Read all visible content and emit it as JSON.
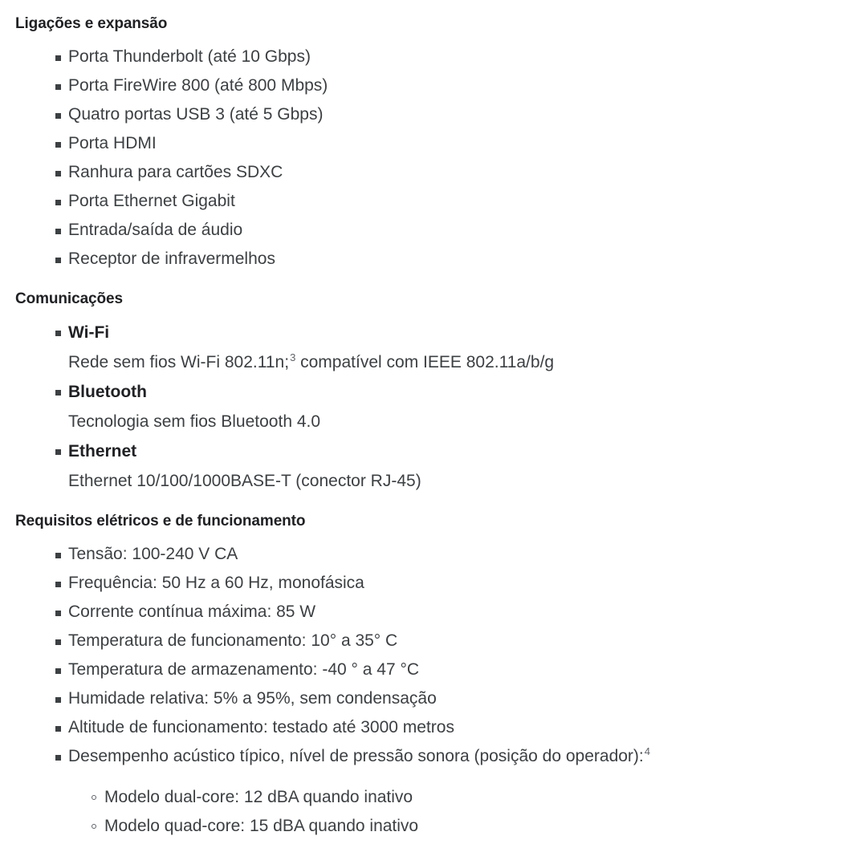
{
  "document": {
    "sections": [
      {
        "id": "ligacoes-e-expansao",
        "heading": "Ligações e expansão",
        "items": [
          {
            "text": "Porta Thunderbolt (até 10 Gbps)"
          },
          {
            "text": "Porta FireWire 800 (até 800 Mbps)"
          },
          {
            "text": "Quatro portas USB 3 (até 5 Gbps)"
          },
          {
            "text": "Porta HDMI"
          },
          {
            "text": "Ranhura para cartões SDXC"
          },
          {
            "text": "Porta Ethernet Gigabit"
          },
          {
            "text": "Entrada/saída de áudio"
          },
          {
            "text": "Receptor de infravermelhos"
          }
        ]
      },
      {
        "id": "comunicacoes",
        "heading": "Comunicações",
        "items": [
          {
            "term": "Wi-Fi",
            "desc_before": "Rede sem fios Wi-Fi 802.11n;",
            "footnote": "3",
            "desc_after": " compatível com IEEE 802.11a/b/g"
          },
          {
            "term": "Bluetooth",
            "desc_before": "Tecnologia sem fios Bluetooth 4.0",
            "footnote": "",
            "desc_after": ""
          },
          {
            "term": "Ethernet",
            "desc_before": "Ethernet 10/100/1000BASE-T (conector RJ-45)",
            "footnote": "",
            "desc_after": ""
          }
        ]
      },
      {
        "id": "requisitos-eletricos",
        "heading": "Requisitos elétricos e de funcionamento",
        "items": [
          {
            "text": "Tensão: 100-240 V CA"
          },
          {
            "text": "Frequência: 50 Hz a 60 Hz, monofásica"
          },
          {
            "text": "Corrente contínua máxima: 85 W"
          },
          {
            "text": "Temperatura de funcionamento: 10° a 35° C"
          },
          {
            "text": "Temperatura de armazenamento: -40 ° a 47 °C"
          },
          {
            "text": "Humidade relativa: 5% a 95%, sem condensação"
          },
          {
            "text": "Altitude de funcionamento: testado até 3000 metros"
          },
          {
            "text": "Desempenho acústico típico, nível de pressão sonora (posição do operador):",
            "footnote": "4",
            "sub_items": [
              {
                "text": "Modelo dual-core: 12 dBA quando inativo"
              },
              {
                "text": "Modelo quad-core: 15 dBA quando inativo"
              }
            ]
          }
        ]
      }
    ]
  },
  "colors": {
    "background": "#ffffff",
    "heading_text": "#202124",
    "body_text": "#3c4043",
    "footnote_text": "#5f6368",
    "bullet": "#3c4043"
  }
}
